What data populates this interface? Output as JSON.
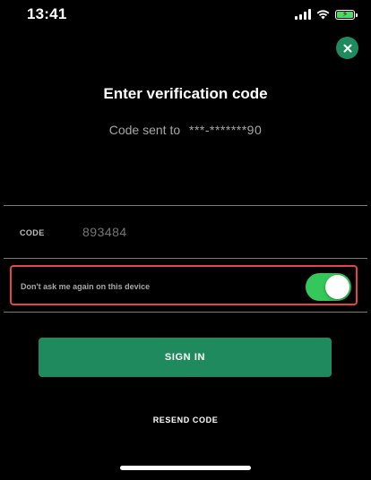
{
  "status_bar": {
    "time": "13:41",
    "signal_icon": "cellular-signal-icon",
    "wifi_icon": "wifi-icon",
    "battery_icon": "battery-charging-icon",
    "battery_color": "#4cd964"
  },
  "close_button": {
    "icon": "close-icon",
    "color": "#1f8a5e"
  },
  "header": {
    "title": "Enter verification code",
    "sent_prefix": "Code sent to",
    "masked_phone": "***-*******90"
  },
  "code_field": {
    "label": "CODE",
    "value": "",
    "placeholder": "893484"
  },
  "remember_device": {
    "label": "Don't ask me again on this device",
    "enabled": true,
    "highlight_color": "#e0464e",
    "toggle_color": "#34c759"
  },
  "actions": {
    "sign_in_label": "SIGN IN",
    "resend_label": "RESEND CODE",
    "primary_color": "#1f8a5e"
  }
}
